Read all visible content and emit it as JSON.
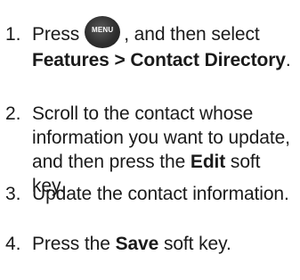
{
  "steps": [
    {
      "number": "1.",
      "parts": {
        "press": "Press",
        "menu_key_label": "MENU",
        "after_key": ", and then select",
        "menu_path": "Features > Contact Directory",
        "end": "."
      }
    },
    {
      "number": "2.",
      "parts": {
        "text": "Scroll to the contact whose information you want to update, and then press the",
        "key": "Edit",
        "end": " soft key."
      }
    },
    {
      "number": "3.",
      "parts": {
        "text": "Update the contact information."
      }
    },
    {
      "number": "4.",
      "parts": {
        "text": "Press the",
        "key": "Save",
        "end": " soft key."
      }
    }
  ],
  "icons": {
    "menu_key": "menu-key-icon"
  }
}
